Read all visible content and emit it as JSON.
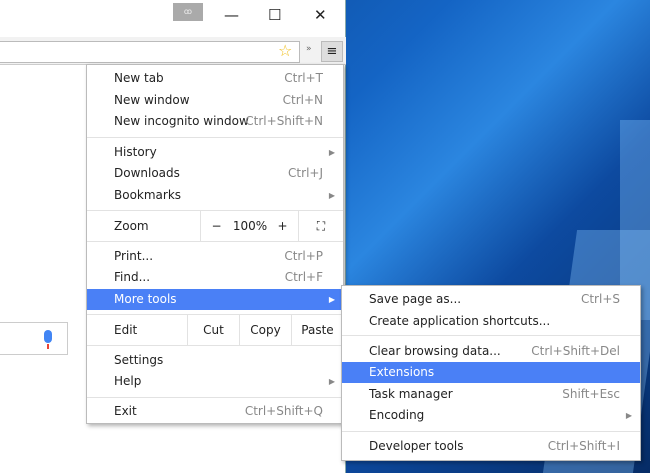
{
  "window": {
    "profile_label": "ꝏ",
    "minimize": "—",
    "maximize": "☐",
    "close": "✕"
  },
  "toolbar": {
    "star_icon": "☆",
    "overflow": "»",
    "menu_icon": "≡"
  },
  "menu": {
    "new_tab": {
      "label": "New tab",
      "shortcut": "Ctrl+T"
    },
    "new_window": {
      "label": "New window",
      "shortcut": "Ctrl+N"
    },
    "incognito": {
      "label": "New incognito window",
      "shortcut": "Ctrl+Shift+N"
    },
    "history": {
      "label": "History"
    },
    "downloads": {
      "label": "Downloads",
      "shortcut": "Ctrl+J"
    },
    "bookmarks": {
      "label": "Bookmarks"
    },
    "zoom": {
      "label": "Zoom",
      "minus": "−",
      "value": "100%",
      "plus": "+",
      "fullscreen": "⛶"
    },
    "print": {
      "label": "Print...",
      "shortcut": "Ctrl+P"
    },
    "find": {
      "label": "Find...",
      "shortcut": "Ctrl+F"
    },
    "more_tools": {
      "label": "More tools"
    },
    "edit": {
      "label": "Edit",
      "cut": "Cut",
      "copy": "Copy",
      "paste": "Paste"
    },
    "settings": {
      "label": "Settings"
    },
    "help": {
      "label": "Help"
    },
    "exit": {
      "label": "Exit",
      "shortcut": "Ctrl+Shift+Q"
    }
  },
  "submenu": {
    "save_page": {
      "label": "Save page as...",
      "shortcut": "Ctrl+S"
    },
    "app_shortcuts": {
      "label": "Create application shortcuts..."
    },
    "clear_data": {
      "label": "Clear browsing data...",
      "shortcut": "Ctrl+Shift+Del"
    },
    "extensions": {
      "label": "Extensions"
    },
    "task_manager": {
      "label": "Task manager",
      "shortcut": "Shift+Esc"
    },
    "encoding": {
      "label": "Encoding"
    },
    "dev_tools": {
      "label": "Developer tools",
      "shortcut": "Ctrl+Shift+I"
    }
  },
  "colors": {
    "highlight": "#4a80f6"
  }
}
